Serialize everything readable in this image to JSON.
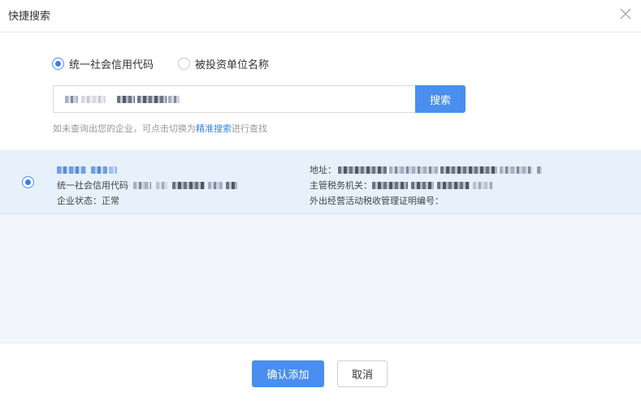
{
  "dialog": {
    "title": "快捷搜索",
    "close_icon": "close-icon"
  },
  "search_type": {
    "options": [
      {
        "label": "统一社会信用代码",
        "selected": true
      },
      {
        "label": "被投资单位名称",
        "selected": false
      }
    ]
  },
  "search": {
    "value": "",
    "button_label": "搜索"
  },
  "hint": {
    "prefix": "如未查询出您的企业，可点击切换为",
    "link": "精准搜索",
    "suffix": "进行查找"
  },
  "results": [
    {
      "selected": true,
      "company_name": "",
      "credit_code_label": "统一社会信用代码",
      "status_label": "企业状态：",
      "status_value": "正常",
      "address_label": "地址：",
      "tax_authority_label": "主管税务机关：",
      "permit_label": "外出经营活动税收管理证明编号："
    }
  ],
  "footer": {
    "confirm_label": "确认添加",
    "cancel_label": "取消"
  },
  "colors": {
    "primary": "#4a8ef0",
    "link": "#3a80ea",
    "result_bg": "#e6f1fc",
    "list_bg": "#f2f6fb"
  }
}
